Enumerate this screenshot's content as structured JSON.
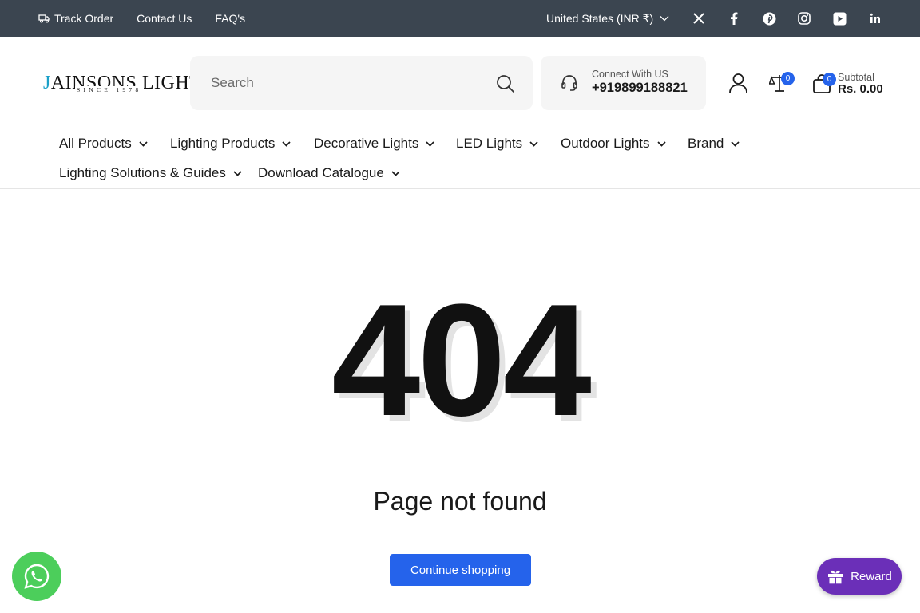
{
  "topbar": {
    "track_order": "Track Order",
    "contact_us": "Contact Us",
    "faq": "FAQ's",
    "region": "United States (INR ₹)",
    "social_icons": [
      "x-icon",
      "facebook-icon",
      "pinterest-icon",
      "instagram-icon",
      "youtube-icon",
      "linkedin-icon"
    ]
  },
  "header": {
    "logo_text": "AINSONS LIGHTS",
    "logo_initial": "J",
    "logo_tagline": "SINCE 1978",
    "search_placeholder": "Search",
    "connect_label": "Connect With US",
    "phone": "+919899188821",
    "compare_count": "0",
    "cart_count": "0",
    "subtotal_label": "Subtotal",
    "subtotal_value": "Rs. 0.00"
  },
  "nav": {
    "items": [
      "All Products",
      "Lighting Products",
      "Decorative Lights",
      "LED Lights",
      "Outdoor Lights",
      "Brand",
      "Lighting Solutions & Guides",
      "Download Catalogue"
    ]
  },
  "main": {
    "error_code": "404",
    "message": "Page not found",
    "button": "Continue shopping"
  },
  "widgets": {
    "reward_label": "Reward"
  },
  "colors": {
    "topbar_bg": "#3b4550",
    "accent": "#2563eb",
    "whatsapp": "#4cce5b",
    "reward": "#6b2fb8"
  }
}
